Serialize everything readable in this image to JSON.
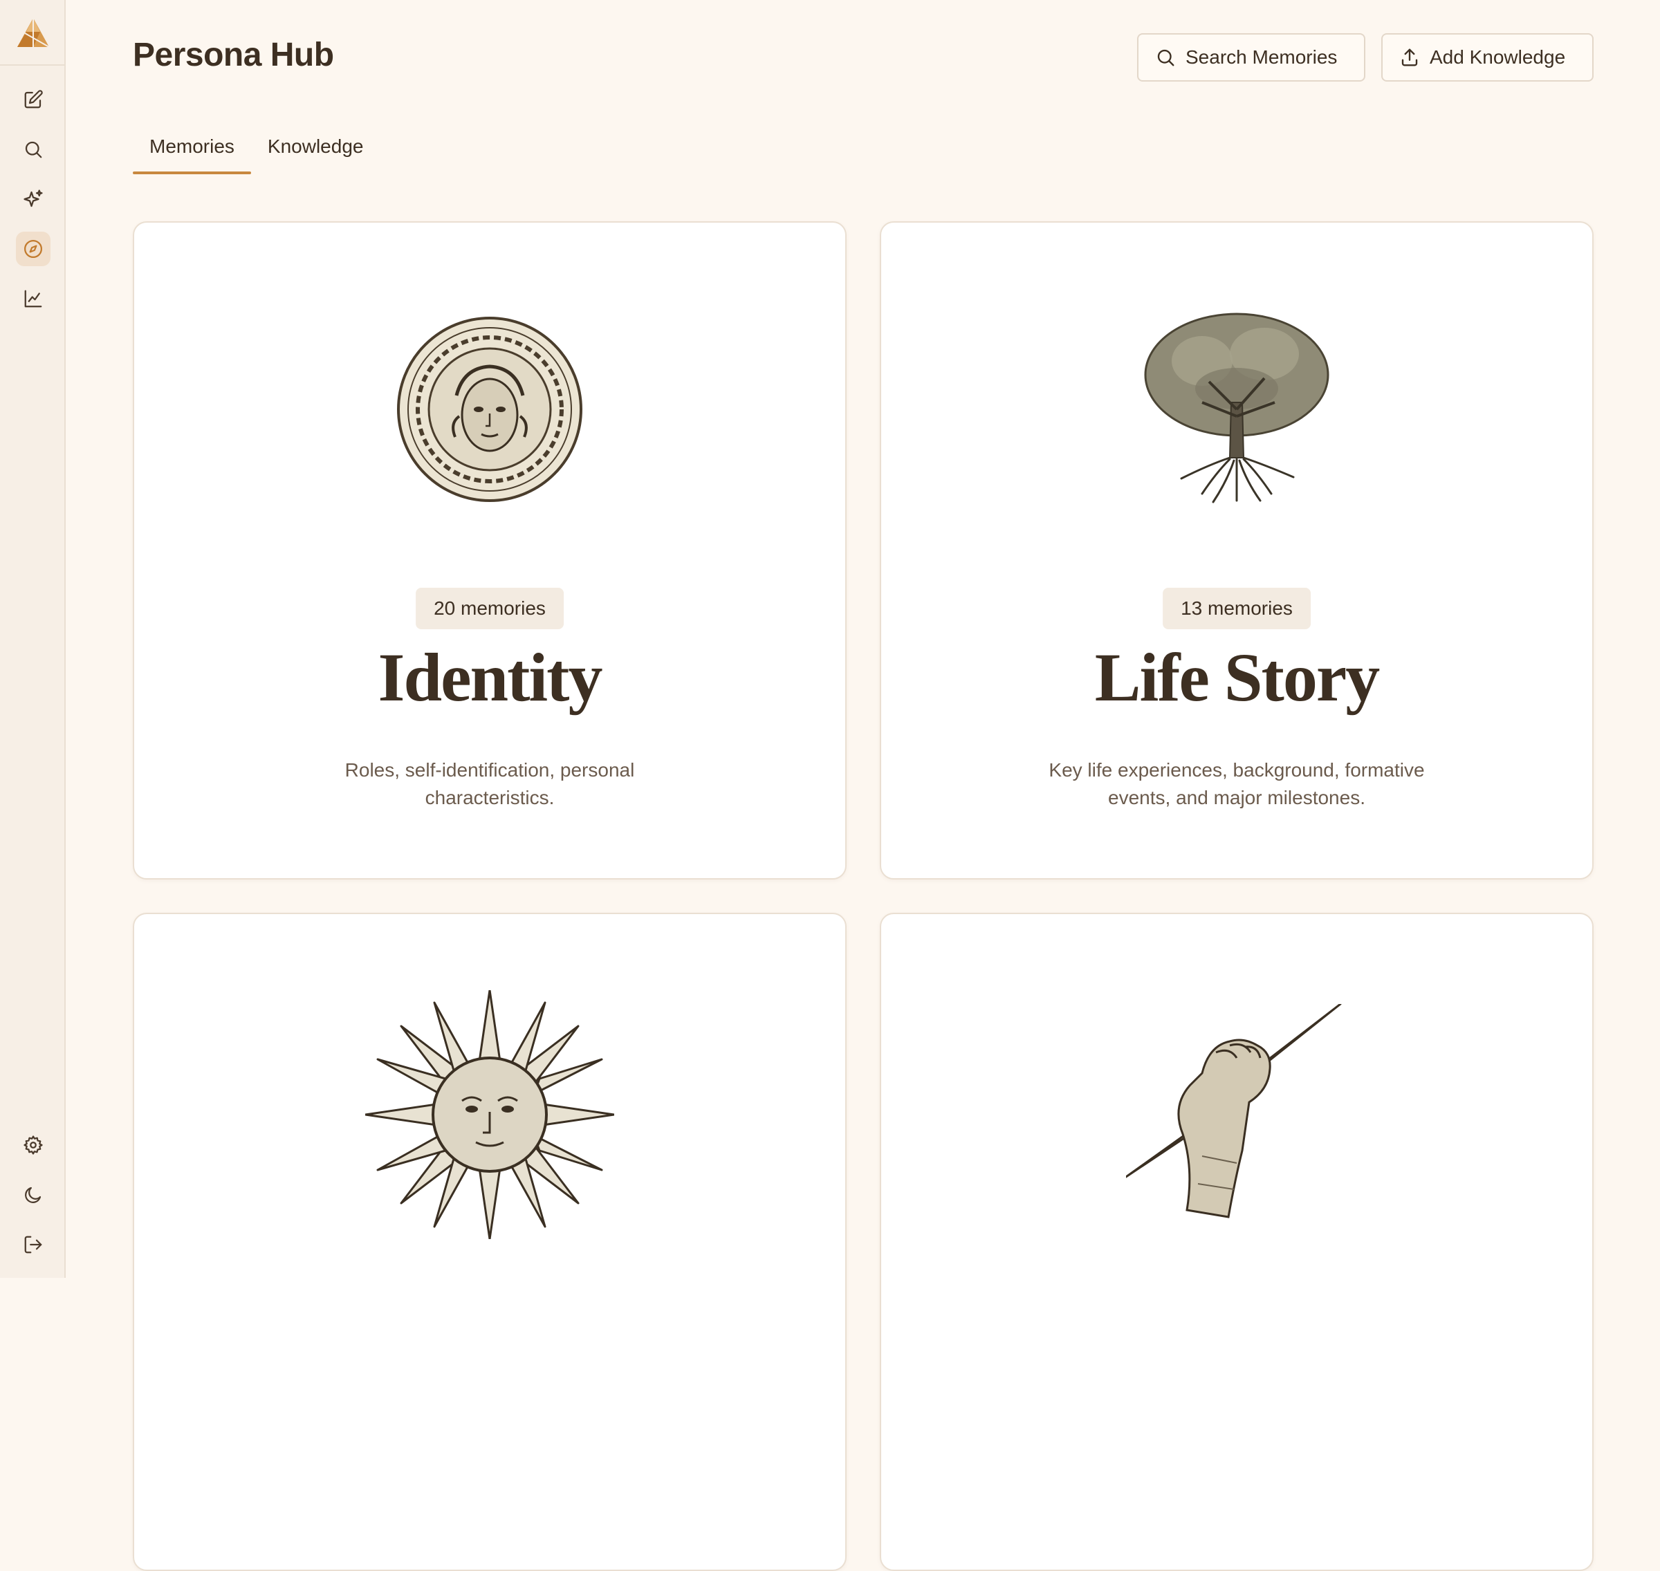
{
  "app": {
    "title": "Persona Hub"
  },
  "sidebar": {
    "logo_icon": "persona-logo",
    "accent": "#c8883f",
    "items": [
      {
        "icon": "edit-icon",
        "active": false
      },
      {
        "icon": "search-icon",
        "active": false
      },
      {
        "icon": "sparkles-icon",
        "active": false
      },
      {
        "icon": "compass-icon",
        "active": true
      },
      {
        "icon": "chart-line-icon",
        "active": false
      }
    ],
    "bottom_items": [
      {
        "icon": "gear-icon"
      },
      {
        "icon": "moon-icon"
      },
      {
        "icon": "logout-icon"
      }
    ]
  },
  "header": {
    "search_label": "Search Memories",
    "add_label": "Add Knowledge"
  },
  "tabs": [
    {
      "label": "Memories",
      "active": true
    },
    {
      "label": "Knowledge",
      "active": false
    }
  ],
  "cards": [
    {
      "badge": "20 memories",
      "title": "Identity",
      "description": "Roles, self-identification, personal characteristics.",
      "art": "medusa-medallion"
    },
    {
      "badge": "13 memories",
      "title": "Life Story",
      "description": "Key life experiences, background, formative events, and major milestones.",
      "art": "tree-of-life"
    },
    {
      "badge": "",
      "title": "",
      "description": "",
      "art": "sun-face"
    },
    {
      "badge": "",
      "title": "",
      "description": "",
      "art": "fist-lightning"
    }
  ]
}
